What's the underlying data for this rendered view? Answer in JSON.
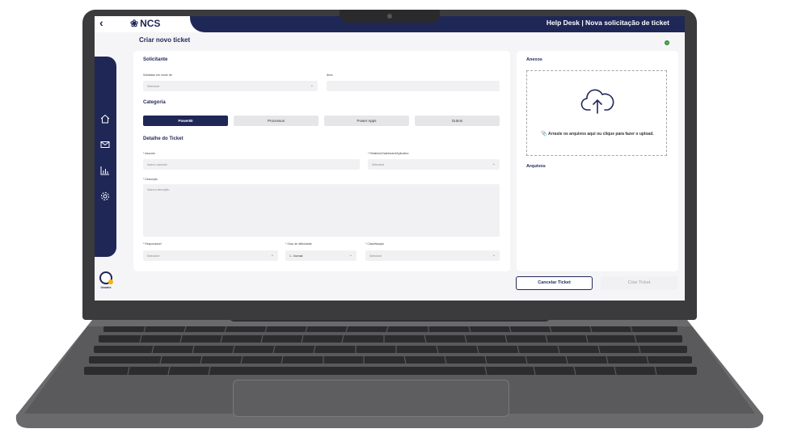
{
  "header": {
    "back_icon": "chevron-left-icon",
    "logo_text": "NCS",
    "title": "Help Desk | Nova solicitação de ticket"
  },
  "page": {
    "title": "Criar novo ticket"
  },
  "sidebar": {
    "items": [
      {
        "icon": "home-icon"
      },
      {
        "icon": "mail-icon"
      },
      {
        "icon": "chart-icon"
      },
      {
        "icon": "gear-icon"
      }
    ],
    "user_label": "Usuario"
  },
  "form": {
    "solicitante": {
      "title": "Solicitante",
      "requested_for_label": "Solicitado em nome de:",
      "requested_for_value": "Selecione",
      "area_label": "Área",
      "area_value": ""
    },
    "categoria": {
      "title": "Categoria",
      "options": [
        "PowerBI",
        "Processos",
        "Power Apps",
        "Outros"
      ],
      "selected": "PowerBI"
    },
    "detalhe": {
      "title": "Detalhe do Ticket",
      "assunto_label": "* Assunto",
      "assunto_placeholder": "Insira o assunto",
      "relatorio_label": "* Relatório/Dashboard/Aplicativo",
      "relatorio_value": "Selecione",
      "descricao_label": "* Descrição",
      "descricao_placeholder": "Insira a descrição",
      "responsavel_label": "* Responsável",
      "responsavel_value": "Selecione",
      "grau_label": "* Grau de dificuldade",
      "grau_value": "1 - Normal",
      "classificacao_label": "* Classificação",
      "classificacao_value": "Selecione"
    }
  },
  "attachments": {
    "title": "Anexos",
    "drop_text": "Arraste os arquivos aqui ou clique para fazer o upload.",
    "upload_icon": "cloud-upload-icon",
    "clip_icon": "paperclip-icon",
    "files_title": "Arquivos"
  },
  "actions": {
    "cancel_label": "Cancelar Ticket",
    "create_label": "Criar Ticket"
  },
  "colors": {
    "brand": "#1f2757",
    "status_dot": "#4caf50"
  }
}
